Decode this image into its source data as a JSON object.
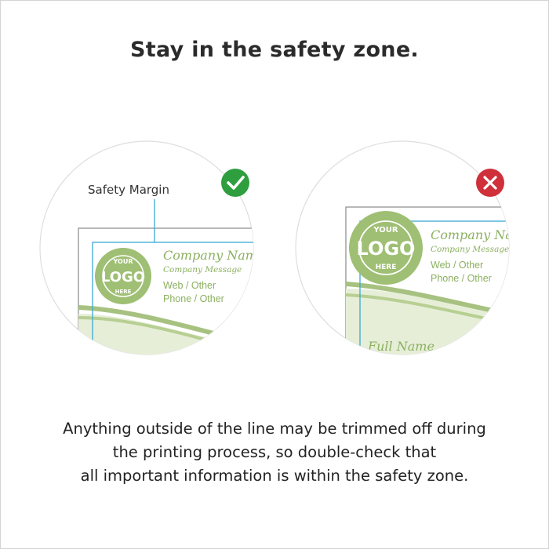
{
  "title": "Stay in the safety zone.",
  "left_example": {
    "status_icon": "check-icon",
    "status_color": "#2e9e3e",
    "callout_label": "Safety Margin",
    "logo": {
      "top_text": "YOUR",
      "main_text": "LOGO",
      "bottom_text": "HERE"
    },
    "company_name": "Company Name",
    "company_message": "Company Message",
    "web": "Web / Other",
    "phone": "Phone / Other"
  },
  "right_example": {
    "status_icon": "x-icon",
    "status_color": "#d0303a",
    "logo": {
      "top_text": "YOUR",
      "main_text": "LOGO",
      "bottom_text": "HERE"
    },
    "company_name": "Company Name",
    "company_message": "Company Message",
    "web": "Web / Other",
    "phone": "Phone / Other",
    "full_name": "Full Name"
  },
  "caption": [
    "Anything outside of the line may be trimmed off during",
    "the printing process, so double-check that",
    "all important information is within the safety zone."
  ],
  "colors": {
    "logo_green": "#9fbf74",
    "guide_blue": "#3aa9d4",
    "trim_gray": "#8a8a8a"
  }
}
